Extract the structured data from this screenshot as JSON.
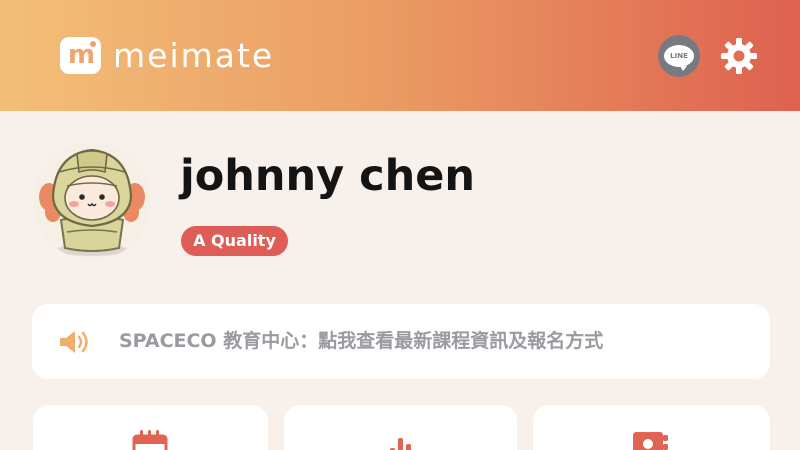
{
  "app": {
    "brand": "meimate",
    "logo_letter": "m"
  },
  "header": {
    "line_button_label": "LINE",
    "line_icon": "line-icon",
    "settings_icon": "gear-icon"
  },
  "profile": {
    "avatar_icon": "mascot-avatar",
    "name": "johnny chen",
    "quality_badge": "A Quality"
  },
  "notice": {
    "icon": "speaker-icon",
    "text": "SPACECO 教育中心：點我查看最新課程資訊及報名方式"
  },
  "cards": [
    {
      "icon": "calendar-icon"
    },
    {
      "icon": "chart-icon"
    },
    {
      "icon": "contacts-book-icon"
    }
  ],
  "colors": {
    "header_gradient_start": "#f3bf78",
    "header_gradient_end": "#de6150",
    "badge": "#de5d56",
    "accent_orange": "#f0a36a",
    "background": "#f8f0ea"
  }
}
